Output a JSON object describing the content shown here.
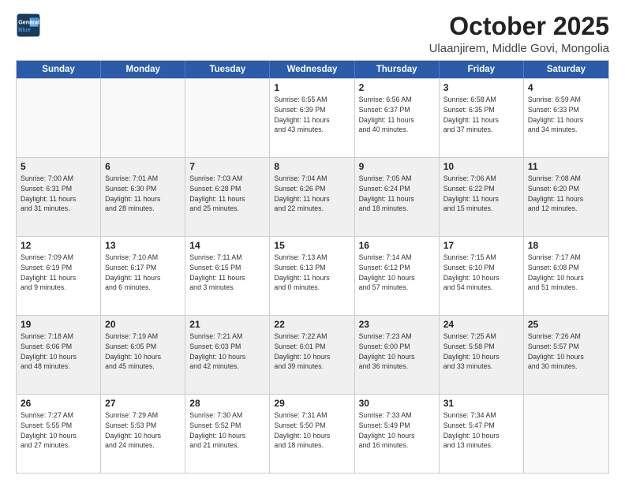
{
  "header": {
    "logo_line1": "General",
    "logo_line2": "Blue",
    "title": "October 2025",
    "subtitle": "Ulaanjirem, Middle Govi, Mongolia"
  },
  "days_of_week": [
    "Sunday",
    "Monday",
    "Tuesday",
    "Wednesday",
    "Thursday",
    "Friday",
    "Saturday"
  ],
  "weeks": [
    [
      {
        "day": "",
        "info": ""
      },
      {
        "day": "",
        "info": ""
      },
      {
        "day": "",
        "info": ""
      },
      {
        "day": "1",
        "info": "Sunrise: 6:55 AM\nSunset: 6:39 PM\nDaylight: 11 hours\nand 43 minutes."
      },
      {
        "day": "2",
        "info": "Sunrise: 6:56 AM\nSunset: 6:37 PM\nDaylight: 11 hours\nand 40 minutes."
      },
      {
        "day": "3",
        "info": "Sunrise: 6:58 AM\nSunset: 6:35 PM\nDaylight: 11 hours\nand 37 minutes."
      },
      {
        "day": "4",
        "info": "Sunrise: 6:59 AM\nSunset: 6:33 PM\nDaylight: 11 hours\nand 34 minutes."
      }
    ],
    [
      {
        "day": "5",
        "info": "Sunrise: 7:00 AM\nSunset: 6:31 PM\nDaylight: 11 hours\nand 31 minutes."
      },
      {
        "day": "6",
        "info": "Sunrise: 7:01 AM\nSunset: 6:30 PM\nDaylight: 11 hours\nand 28 minutes."
      },
      {
        "day": "7",
        "info": "Sunrise: 7:03 AM\nSunset: 6:28 PM\nDaylight: 11 hours\nand 25 minutes."
      },
      {
        "day": "8",
        "info": "Sunrise: 7:04 AM\nSunset: 6:26 PM\nDaylight: 11 hours\nand 22 minutes."
      },
      {
        "day": "9",
        "info": "Sunrise: 7:05 AM\nSunset: 6:24 PM\nDaylight: 11 hours\nand 18 minutes."
      },
      {
        "day": "10",
        "info": "Sunrise: 7:06 AM\nSunset: 6:22 PM\nDaylight: 11 hours\nand 15 minutes."
      },
      {
        "day": "11",
        "info": "Sunrise: 7:08 AM\nSunset: 6:20 PM\nDaylight: 11 hours\nand 12 minutes."
      }
    ],
    [
      {
        "day": "12",
        "info": "Sunrise: 7:09 AM\nSunset: 6:19 PM\nDaylight: 11 hours\nand 9 minutes."
      },
      {
        "day": "13",
        "info": "Sunrise: 7:10 AM\nSunset: 6:17 PM\nDaylight: 11 hours\nand 6 minutes."
      },
      {
        "day": "14",
        "info": "Sunrise: 7:11 AM\nSunset: 6:15 PM\nDaylight: 11 hours\nand 3 minutes."
      },
      {
        "day": "15",
        "info": "Sunrise: 7:13 AM\nSunset: 6:13 PM\nDaylight: 11 hours\nand 0 minutes."
      },
      {
        "day": "16",
        "info": "Sunrise: 7:14 AM\nSunset: 6:12 PM\nDaylight: 10 hours\nand 57 minutes."
      },
      {
        "day": "17",
        "info": "Sunrise: 7:15 AM\nSunset: 6:10 PM\nDaylight: 10 hours\nand 54 minutes."
      },
      {
        "day": "18",
        "info": "Sunrise: 7:17 AM\nSunset: 6:08 PM\nDaylight: 10 hours\nand 51 minutes."
      }
    ],
    [
      {
        "day": "19",
        "info": "Sunrise: 7:18 AM\nSunset: 6:06 PM\nDaylight: 10 hours\nand 48 minutes."
      },
      {
        "day": "20",
        "info": "Sunrise: 7:19 AM\nSunset: 6:05 PM\nDaylight: 10 hours\nand 45 minutes."
      },
      {
        "day": "21",
        "info": "Sunrise: 7:21 AM\nSunset: 6:03 PM\nDaylight: 10 hours\nand 42 minutes."
      },
      {
        "day": "22",
        "info": "Sunrise: 7:22 AM\nSunset: 6:01 PM\nDaylight: 10 hours\nand 39 minutes."
      },
      {
        "day": "23",
        "info": "Sunrise: 7:23 AM\nSunset: 6:00 PM\nDaylight: 10 hours\nand 36 minutes."
      },
      {
        "day": "24",
        "info": "Sunrise: 7:25 AM\nSunset: 5:58 PM\nDaylight: 10 hours\nand 33 minutes."
      },
      {
        "day": "25",
        "info": "Sunrise: 7:26 AM\nSunset: 5:57 PM\nDaylight: 10 hours\nand 30 minutes."
      }
    ],
    [
      {
        "day": "26",
        "info": "Sunrise: 7:27 AM\nSunset: 5:55 PM\nDaylight: 10 hours\nand 27 minutes."
      },
      {
        "day": "27",
        "info": "Sunrise: 7:29 AM\nSunset: 5:53 PM\nDaylight: 10 hours\nand 24 minutes."
      },
      {
        "day": "28",
        "info": "Sunrise: 7:30 AM\nSunset: 5:52 PM\nDaylight: 10 hours\nand 21 minutes."
      },
      {
        "day": "29",
        "info": "Sunrise: 7:31 AM\nSunset: 5:50 PM\nDaylight: 10 hours\nand 18 minutes."
      },
      {
        "day": "30",
        "info": "Sunrise: 7:33 AM\nSunset: 5:49 PM\nDaylight: 10 hours\nand 16 minutes."
      },
      {
        "day": "31",
        "info": "Sunrise: 7:34 AM\nSunset: 5:47 PM\nDaylight: 10 hours\nand 13 minutes."
      },
      {
        "day": "",
        "info": ""
      }
    ]
  ]
}
